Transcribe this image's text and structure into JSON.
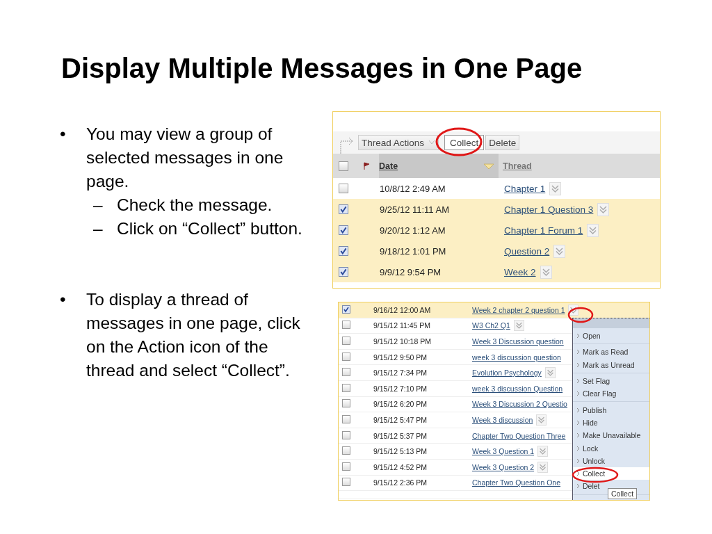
{
  "title": "Display Multiple Messages in One Page",
  "bullets": [
    {
      "marker": "•",
      "text": "You may view a group of selected messages in one page.",
      "children": [
        {
          "marker": "–",
          "text": "Check the message."
        },
        {
          "marker": "–",
          "text": "Click on “Collect” button."
        }
      ]
    },
    {
      "marker": "•",
      "text": "To display a thread of messages in one page, click on the Action icon of the thread and select “Collect”."
    }
  ],
  "top_shot": {
    "menu_button": "Thread Actions",
    "buttons": [
      "Collect",
      "Delete"
    ],
    "header": {
      "checked": false,
      "date": "Date",
      "thread": "Thread"
    },
    "rows": [
      {
        "checked": false,
        "date": "10/8/12 2:49 AM",
        "thread": "Chapter 1",
        "action_icon": true
      },
      {
        "checked": true,
        "date": "9/25/12 11:11 AM",
        "thread": "Chapter 1 Question 3",
        "action_icon": true
      },
      {
        "checked": true,
        "date": "9/20/12 1:12 AM",
        "thread": "Chapter 1 Forum 1",
        "action_icon": true
      },
      {
        "checked": true,
        "date": "9/18/12 1:01 PM",
        "thread": "Question 2",
        "action_icon": true
      },
      {
        "checked": true,
        "date": "9/9/12 9:54 PM",
        "thread": "Week 2",
        "action_icon": true
      }
    ]
  },
  "bottom_shot": {
    "rows": [
      {
        "checked": true,
        "date": "9/16/12 12:00 AM",
        "thread": "Week 2 chapter 2 question 1",
        "action_icon": true
      },
      {
        "checked": false,
        "date": "9/15/12 11:45 PM",
        "thread": "W3 Ch2 Q1",
        "action_icon": true
      },
      {
        "checked": false,
        "date": "9/15/12 10:18 PM",
        "thread": "Week 3 Discussion question",
        "action_icon": false
      },
      {
        "checked": false,
        "date": "9/15/12 9:50 PM",
        "thread": "week 3 discussion question",
        "action_icon": false
      },
      {
        "checked": false,
        "date": "9/15/12 7:34 PM",
        "thread": "Evolution Psychology",
        "action_icon": true
      },
      {
        "checked": false,
        "date": "9/15/12 7:10 PM",
        "thread": "week 3 discussion Question",
        "action_icon": false
      },
      {
        "checked": false,
        "date": "9/15/12 6:20 PM",
        "thread": "Week 3 Discussion 2 Questio",
        "action_icon": false
      },
      {
        "checked": false,
        "date": "9/15/12 5:47 PM",
        "thread": "Week 3 discussion",
        "action_icon": true
      },
      {
        "checked": false,
        "date": "9/15/12 5:37 PM",
        "thread": "Chapter Two Question Three",
        "action_icon": false
      },
      {
        "checked": false,
        "date": "9/15/12 5:13 PM",
        "thread": "Week 3 Question 1",
        "action_icon": true
      },
      {
        "checked": false,
        "date": "9/15/12 4:52 PM",
        "thread": "Week 3 Question 2",
        "action_icon": true
      },
      {
        "checked": false,
        "date": "9/15/12 2:36 PM",
        "thread": "Chapter Two Question One",
        "action_icon": false
      }
    ],
    "menu": {
      "groups": [
        [
          {
            "label": "Open",
            "selected": false
          }
        ],
        [
          {
            "label": "Mark as Read",
            "selected": false
          },
          {
            "label": "Mark as Unread",
            "selected": false
          }
        ],
        [
          {
            "label": "Set Flag",
            "selected": false
          },
          {
            "label": "Clear Flag",
            "selected": false
          }
        ],
        [
          {
            "label": "Publish",
            "selected": false
          },
          {
            "label": "Hide",
            "selected": false
          },
          {
            "label": "Make Unavailable",
            "selected": false
          },
          {
            "label": "Lock",
            "selected": false
          },
          {
            "label": "Unlock",
            "selected": false
          },
          {
            "label": "Collect",
            "selected": true
          },
          {
            "label": "Delet",
            "selected": false
          }
        ]
      ],
      "tooltip": "Collect"
    }
  }
}
